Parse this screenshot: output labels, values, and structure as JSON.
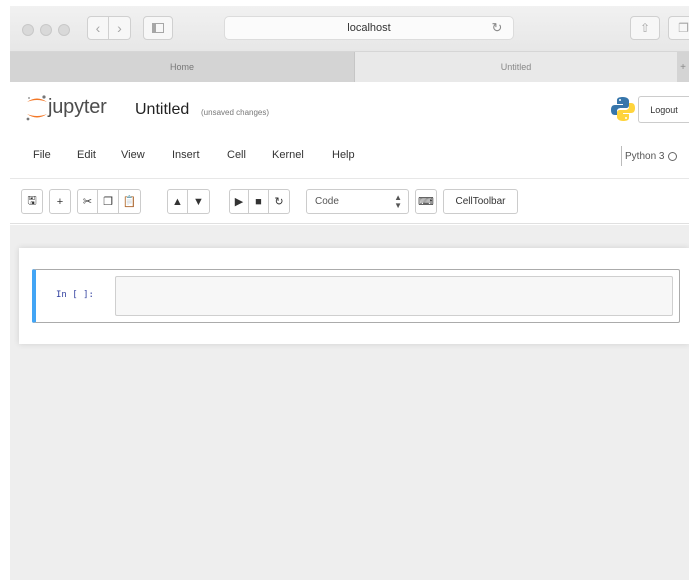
{
  "browser": {
    "url": "localhost",
    "tabs": [
      {
        "label": "Home",
        "active": false
      },
      {
        "label": "Untitled",
        "active": true
      }
    ]
  },
  "header": {
    "wordmark": "jupyter",
    "notebook_name": "Untitled",
    "save_status": "(unsaved changes)",
    "logout_label": "Logout"
  },
  "menu": {
    "file": "File",
    "edit": "Edit",
    "view": "View",
    "insert": "Insert",
    "cell": "Cell",
    "kernel": "Kernel",
    "help": "Help"
  },
  "kernel": {
    "name": "Python 3"
  },
  "toolbar": {
    "cell_type": "Code",
    "cell_toolbar_label": "CellToolbar"
  },
  "cell": {
    "prompt": "In [ ]:",
    "source": ""
  },
  "colors": {
    "jupyter_orange": "#f37726",
    "cell_selected_border": "#42a5f5",
    "prompt_blue": "#303f9f",
    "site_background": "#eeeeee"
  }
}
